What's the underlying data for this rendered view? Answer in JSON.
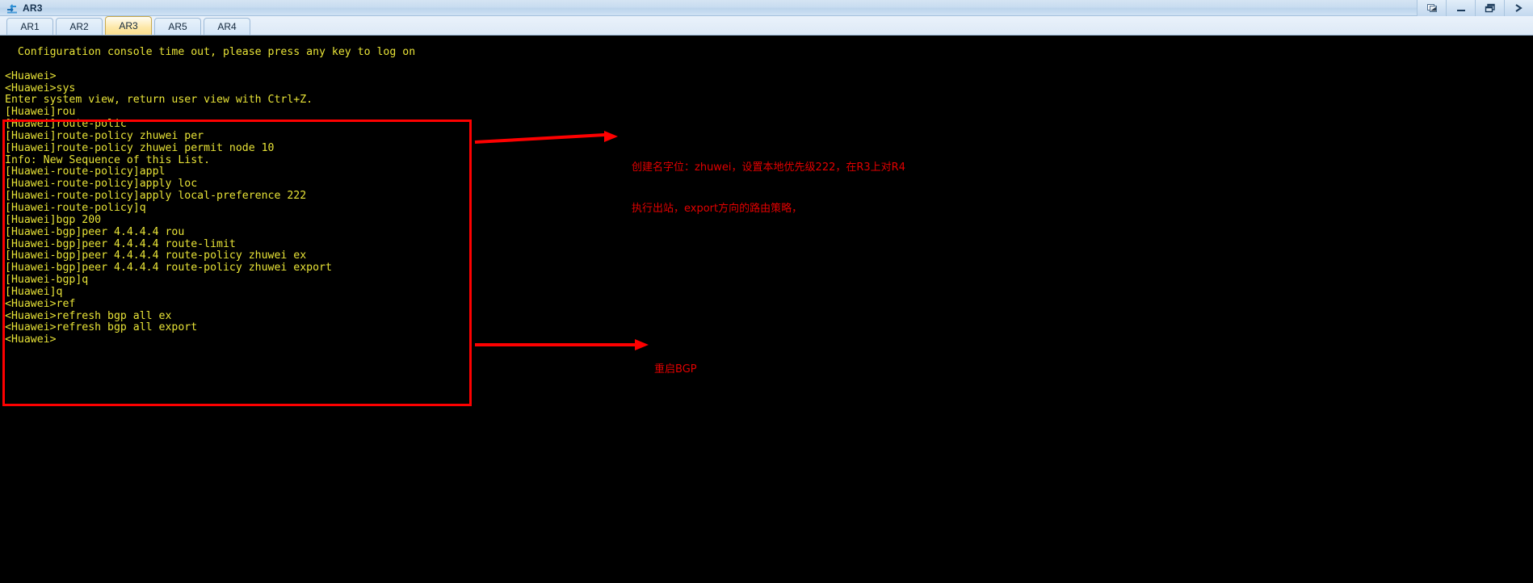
{
  "window": {
    "title": "AR3",
    "icon": "router-icon",
    "controls": [
      {
        "name": "restore-window-button",
        "glyph": "restore-icon"
      },
      {
        "name": "minimize-window-button",
        "glyph": "minimize-icon"
      },
      {
        "name": "maximize-window-button",
        "glyph": "maximize-icon"
      },
      {
        "name": "close-window-button",
        "glyph": "close-icon"
      }
    ]
  },
  "tabs": {
    "items": [
      {
        "label": "AR1",
        "active": false
      },
      {
        "label": "AR2",
        "active": false
      },
      {
        "label": "AR3",
        "active": true
      },
      {
        "label": "AR5",
        "active": false
      },
      {
        "label": "AR4",
        "active": false
      }
    ]
  },
  "terminal": {
    "foreground": "#e8e337",
    "background": "#000000",
    "lines": [
      "  Configuration console time out, please press any key to log on",
      "",
      "<Huawei>",
      "<Huawei>sys",
      "Enter system view, return user view with Ctrl+Z.",
      "[Huawei]rou",
      "[Huawei]route-polic",
      "[Huawei]route-policy zhuwei per",
      "[Huawei]route-policy zhuwei permit node 10",
      "Info: New Sequence of this List.",
      "[Huawei-route-policy]appl",
      "[Huawei-route-policy]apply loc",
      "[Huawei-route-policy]apply local-preference 222",
      "[Huawei-route-policy]q",
      "[Huawei]bgp 200",
      "[Huawei-bgp]peer 4.4.4.4 rou",
      "[Huawei-bgp]peer 4.4.4.4 route-limit",
      "[Huawei-bgp]peer 4.4.4.4 route-policy zhuwei ex",
      "[Huawei-bgp]peer 4.4.4.4 route-policy zhuwei export",
      "[Huawei-bgp]q",
      "[Huawei]q",
      "<Huawei>ref",
      "<Huawei>refresh bgp all ex",
      "<Huawei>refresh bgp all export",
      "<Huawei>"
    ]
  },
  "annotations": {
    "color": "#e20000",
    "highlight_box": {
      "name": "config-highlight-box"
    },
    "notes": [
      {
        "name": "route-policy-note",
        "line1": "创建名字位：zhuwei，设置本地优先级222，在R3上对R4",
        "line2": "执行出站，export方向的路由策略，"
      },
      {
        "name": "restart-bgp-note",
        "line1": "重启BGP",
        "line2": ""
      }
    ]
  }
}
